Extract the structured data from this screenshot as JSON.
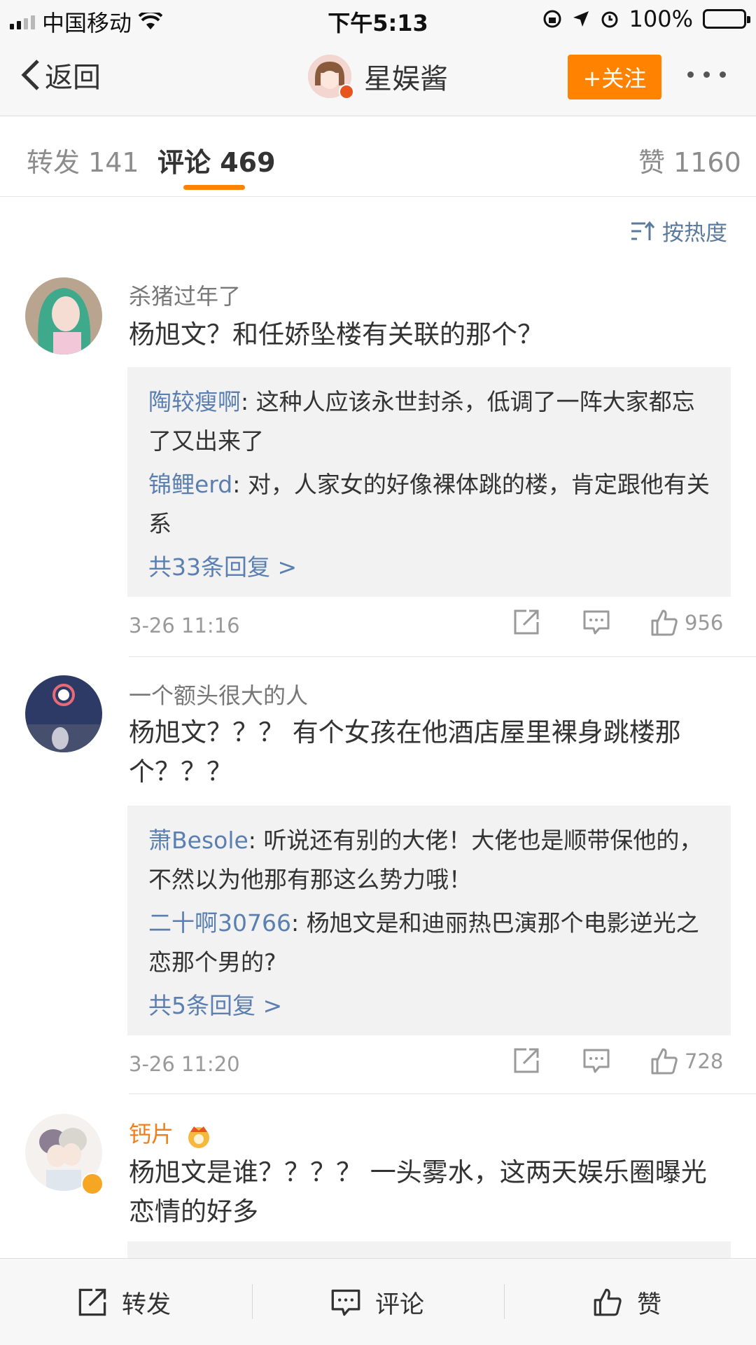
{
  "status_bar": {
    "carrier": "中国移动",
    "time": "下午5:13",
    "battery": "100%"
  },
  "nav": {
    "back_label": "返回",
    "title": "星娱酱",
    "follow_label": "+关注"
  },
  "tabs": {
    "repost": "转发 141",
    "comments": "评论 469",
    "likes": "赞 1160"
  },
  "sort_label": "按热度",
  "comments": [
    {
      "username": "杀猪过年了",
      "text": "杨旭文？和任娇坠楼有关联的那个？",
      "replies": [
        {
          "name": "陶较瘦啊",
          "text": ": 这种人应该永世封杀，低调了一阵大家都忘了又出来了"
        },
        {
          "name": "锦鲤erd",
          "text": ": 对，人家女的好像裸体跳的楼，肯定跟他有关系"
        }
      ],
      "more_replies": "共33条回复 >",
      "time": "3-26 11:16",
      "likes": "956"
    },
    {
      "username": "一个额头很大的人",
      "text": "杨旭文？？？ 有个女孩在他酒店屋里裸身跳楼那个？？？",
      "replies": [
        {
          "name": "萧Besole",
          "text": ": 听说还有别的大佬！大佬也是顺带保他的，不然以为他那有那这么势力哦！"
        },
        {
          "name": "二十啊30766",
          "text": ": 杨旭文是和迪丽热巴演那个电影逆光之恋那个男的?"
        }
      ],
      "more_replies": "共5条回复 >",
      "time": "3-26 11:20",
      "likes": "728"
    },
    {
      "username": "钙片",
      "text": "杨旭文是谁？？？？ 一头雾水，这两天娱乐圈曝光恋情的好多"
    }
  ],
  "bottom_bar": {
    "repost": "转发",
    "comment": "评论",
    "like": "赞"
  },
  "colors": {
    "accent": "#ff8200",
    "link": "#5a7fb0",
    "vip_name": "#f07f1f"
  }
}
